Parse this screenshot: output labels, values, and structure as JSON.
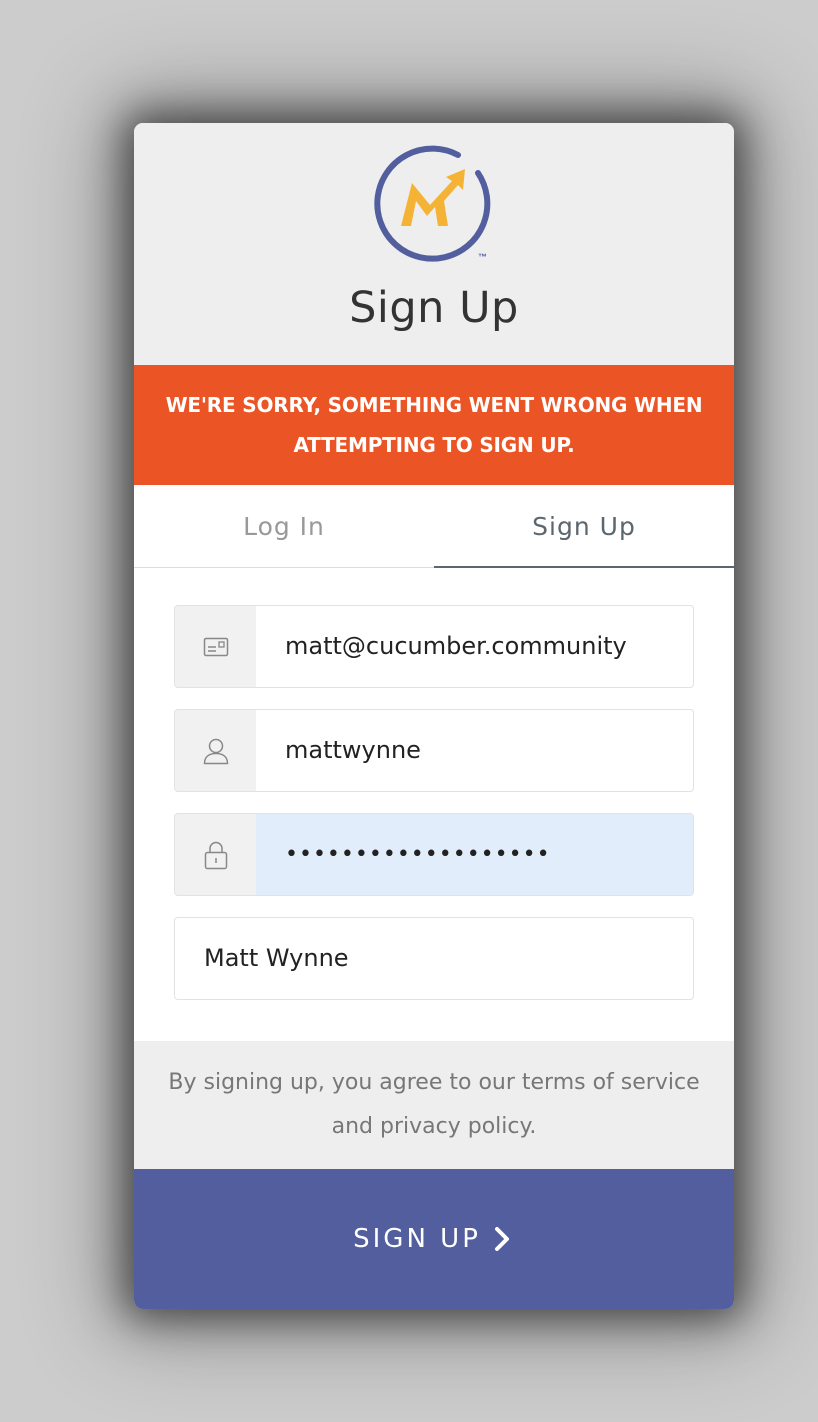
{
  "header": {
    "title": "Sign Up",
    "logo_trademark": "™"
  },
  "error": {
    "message": "WE'RE SORRY, SOMETHING WENT WRONG WHEN ATTEMPTING TO SIGN UP."
  },
  "tabs": [
    {
      "label": "Log In",
      "active": false
    },
    {
      "label": "Sign Up",
      "active": true
    }
  ],
  "form": {
    "email": {
      "value": "matt@cucumber.community",
      "icon": "email-icon"
    },
    "username": {
      "value": "mattwynne",
      "icon": "user-icon"
    },
    "password": {
      "value": "•••••••••••••••••••",
      "icon": "lock-icon"
    },
    "name": {
      "value": "Matt Wynne"
    }
  },
  "terms": {
    "text": "By signing up, you agree to our terms of service and privacy policy."
  },
  "submit": {
    "label": "SIGN UP"
  },
  "colors": {
    "brand_primary": "#525e9e",
    "error": "#eb5424",
    "logo_accent": "#f5b335",
    "header_bg": "#eeeeee"
  }
}
